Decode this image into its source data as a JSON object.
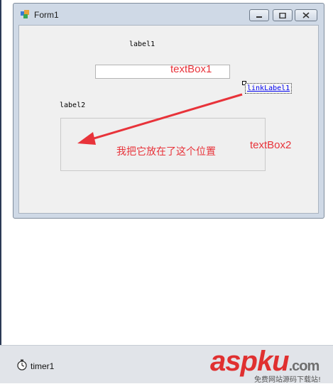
{
  "form": {
    "title": "Form1",
    "label1": "label1",
    "label2": "label2",
    "textbox1_annotation": "textBox1",
    "linklabel": "linkLabel1",
    "textbox2_annotation": "textBox2",
    "arrow_annotation": "我把它放在了这个位置"
  },
  "tray": {
    "timer_label": "timer1"
  },
  "watermark": {
    "asp": "asp",
    "ku": "ku",
    "com": ".com",
    "subtitle": "免费网站源码下载站!"
  },
  "colors": {
    "annotation": "#e8333a",
    "link": "#0000ee"
  }
}
